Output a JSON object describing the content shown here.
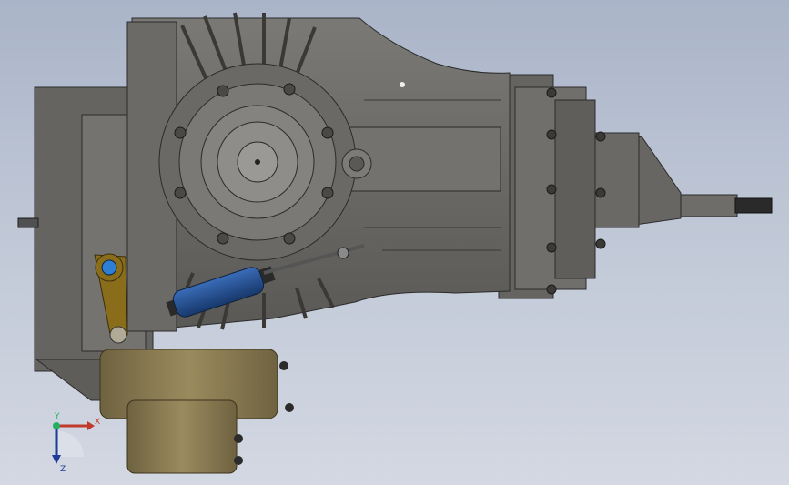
{
  "viewport": {
    "background_top": "#aab4c8",
    "background_bottom": "#d3d8e2"
  },
  "model": {
    "housing_color": "#6d6c68",
    "housing_dark": "#4f4e4b",
    "brass_color": "#8a7c52",
    "actuator_color": "#1f4a8a",
    "linkage_color": "#8a6d1a"
  },
  "triad": {
    "x_label": "X",
    "y_label": "Y",
    "z_label": "Z",
    "x_color": "#c0392b",
    "y_color": "#27ae60",
    "z_color": "#1f3c9a"
  }
}
